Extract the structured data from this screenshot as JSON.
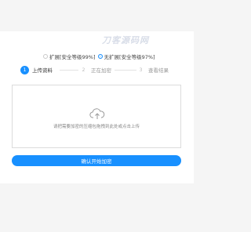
{
  "watermark": "刀客源码网",
  "modes": [
    {
      "label": "扩展[安全等级99%]",
      "checked": false
    },
    {
      "label": "无扩展[安全等级97%]",
      "checked": true
    }
  ],
  "steps": [
    {
      "num": "1",
      "label": "上传资料",
      "active": true
    },
    {
      "num": "2",
      "label": "正在加密",
      "active": false
    },
    {
      "num": "3",
      "label": "查看结果",
      "active": false
    }
  ],
  "upload": {
    "icon": "cloud-upload-icon",
    "hint": "请把需要加密的压缩包拖拽到此处或点击上传"
  },
  "submit_label": "确认开始加密",
  "colors": {
    "primary": "#1890ff"
  }
}
